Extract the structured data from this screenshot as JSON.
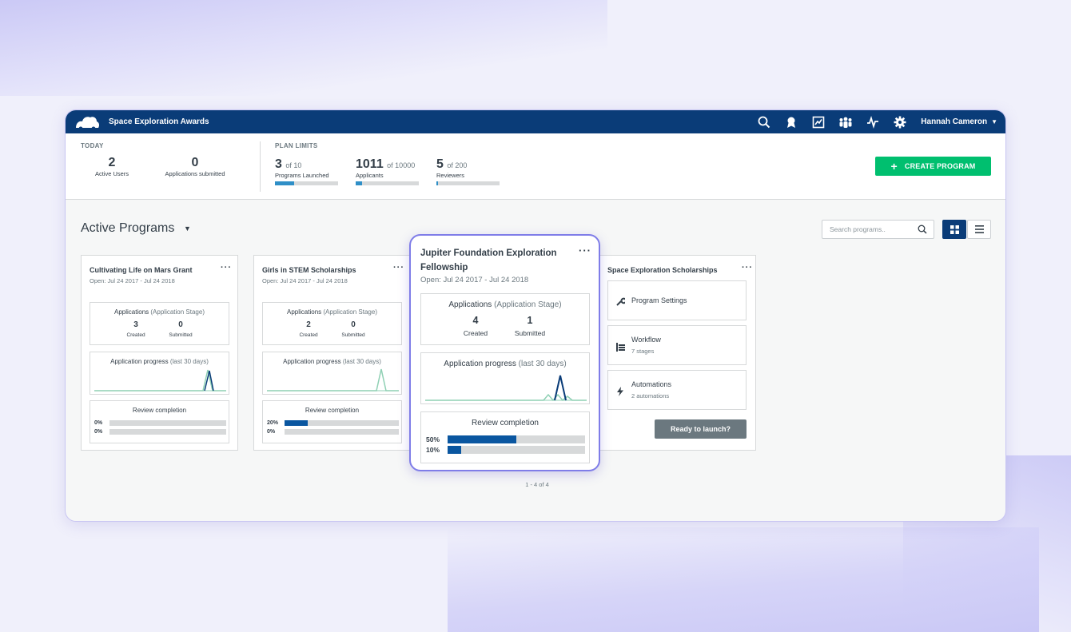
{
  "header": {
    "app_title": "Space Exploration Awards",
    "user_name": "Hannah Cameron"
  },
  "today": {
    "label": "TODAY",
    "active_users": {
      "value": "2",
      "caption": "Active Users"
    },
    "applications_submitted": {
      "value": "0",
      "caption": "Applications submitted"
    }
  },
  "plan_limits": {
    "label": "PLAN LIMITS",
    "items": [
      {
        "value": "3",
        "of": "of 10",
        "caption": "Programs Launched",
        "fraction": 0.3
      },
      {
        "value": "1011",
        "of": "of 10000",
        "caption": "Applicants",
        "fraction": 0.1
      },
      {
        "value": "5",
        "of": "of 200",
        "caption": "Reviewers",
        "fraction": 0.025
      }
    ]
  },
  "create_button": {
    "label": "CREATE PROGRAM"
  },
  "programs": {
    "title": "Active Programs",
    "search_placeholder": "Search programs..",
    "pager": "1 - 4 of 4"
  },
  "cards": [
    {
      "title": "Cultivating Life on Mars Grant",
      "dates": "Open: Jul 24 2017 - Jul 24 2018",
      "apps_head": "Applications",
      "apps_stage": "(Application Stage)",
      "created": "3",
      "created_label": "Created",
      "submitted": "0",
      "submitted_label": "Submitted",
      "progress_head": "Application progress",
      "progress_range": "(last 30 days)",
      "review_head": "Review completion",
      "review": [
        {
          "pct": "0%",
          "value": 0
        },
        {
          "pct": "0%",
          "value": 0
        }
      ]
    },
    {
      "title": "Girls in STEM Scholarships",
      "dates": "Open: Jul 24 2017 - Jul 24 2018",
      "apps_head": "Applications",
      "apps_stage": "(Application Stage)",
      "created": "2",
      "created_label": "Created",
      "submitted": "0",
      "submitted_label": "Submitted",
      "progress_head": "Application progress",
      "progress_range": "(last 30 days)",
      "review_head": "Review completion",
      "review": [
        {
          "pct": "20%",
          "value": 0.2
        },
        {
          "pct": "0%",
          "value": 0
        }
      ]
    },
    {
      "title": "Jupiter Foundation Exploration Fellowship",
      "dates": "Open: Jul 24 2017 - Jul 24 2018",
      "apps_head": "Applications",
      "apps_stage": "(Application Stage)",
      "created": "4",
      "created_label": "Created",
      "submitted": "1",
      "submitted_label": "Submitted",
      "progress_head": "Application progress",
      "progress_range": "(last 30 days)",
      "review_head": "Review completion",
      "review": [
        {
          "pct": "50%",
          "value": 0.5
        },
        {
          "pct": "10%",
          "value": 0.1
        }
      ]
    },
    {
      "title": "Space Exploration Scholarships",
      "menu": [
        {
          "label": "Program Settings",
          "sub": "",
          "icon": "wrench-icon"
        },
        {
          "label": "Workflow",
          "sub": "7 stages",
          "icon": "workflow-icon"
        },
        {
          "label": "Automations",
          "sub": "2 automations",
          "icon": "lightning-icon"
        }
      ],
      "launch_label": "Ready to launch?"
    }
  ],
  "colors": {
    "header_bg": "#0a3c78",
    "accent_green": "#00bf6f",
    "bar_blue": "#0a56a0",
    "spark_teal": "#8fd0b4"
  }
}
